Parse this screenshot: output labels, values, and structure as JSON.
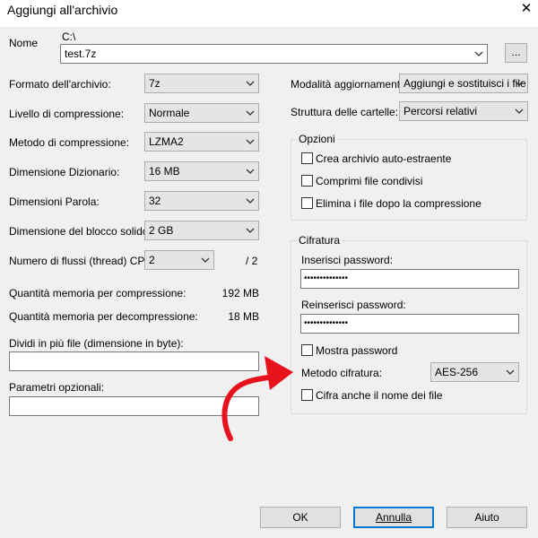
{
  "window": {
    "title": "Aggiungi all'archivio",
    "close_glyph": "✕"
  },
  "name": {
    "label": "Nome",
    "path": "C:\\",
    "value": "test.7z",
    "browse_label": "..."
  },
  "left": {
    "format": {
      "label": "Formato dell'archivio:",
      "value": "7z"
    },
    "level": {
      "label": "Livello di compressione:",
      "value": "Normale"
    },
    "method": {
      "label": "Metodo di compressione:",
      "value": "LZMA2"
    },
    "dict": {
      "label": "Dimensione Dizionario:",
      "value": "16 MB"
    },
    "word": {
      "label": "Dimensioni Parola:",
      "value": "32"
    },
    "solid": {
      "label": "Dimensione del blocco solido:",
      "value": "2 GB"
    },
    "threads": {
      "label": "Numero di flussi (thread) CPU:",
      "value": "2",
      "total": "/ 2"
    },
    "mem_comp": {
      "label": "Quantità memoria per compressione:",
      "value": "192 MB"
    },
    "mem_decomp": {
      "label": "Quantità memoria per decompressione:",
      "value": "18 MB"
    },
    "split": {
      "label": "Dividi in più file (dimensione in byte):",
      "value": ""
    },
    "params": {
      "label": "Parametri opzionali:",
      "value": ""
    }
  },
  "right": {
    "update": {
      "label": "Modalità aggiornamento:",
      "value": "Aggiungi e sostituisci i file"
    },
    "paths": {
      "label": "Struttura delle cartelle:",
      "value": "Percorsi relativi"
    },
    "options": {
      "title": "Opzioni",
      "sfx": "Crea archivio auto-estraente",
      "shared": "Comprimi file condivisi",
      "delete": "Elimina i file dopo la compressione"
    },
    "encryption": {
      "title": "Cifratura",
      "enter_label": "Inserisci password:",
      "enter_value": "••••••••••••••",
      "reenter_label": "Reinserisci password:",
      "reenter_value": "••••••••••••••",
      "show_password": "Mostra password",
      "method_label": "Metodo cifratura:",
      "method_value": "AES-256",
      "encrypt_names": "Cifra anche il nome dei file"
    }
  },
  "buttons": {
    "ok": "OK",
    "cancel": "Annulla",
    "help": "Aiuto"
  },
  "colors": {
    "arrow": "#e8121d",
    "focus": "#0078d7"
  }
}
